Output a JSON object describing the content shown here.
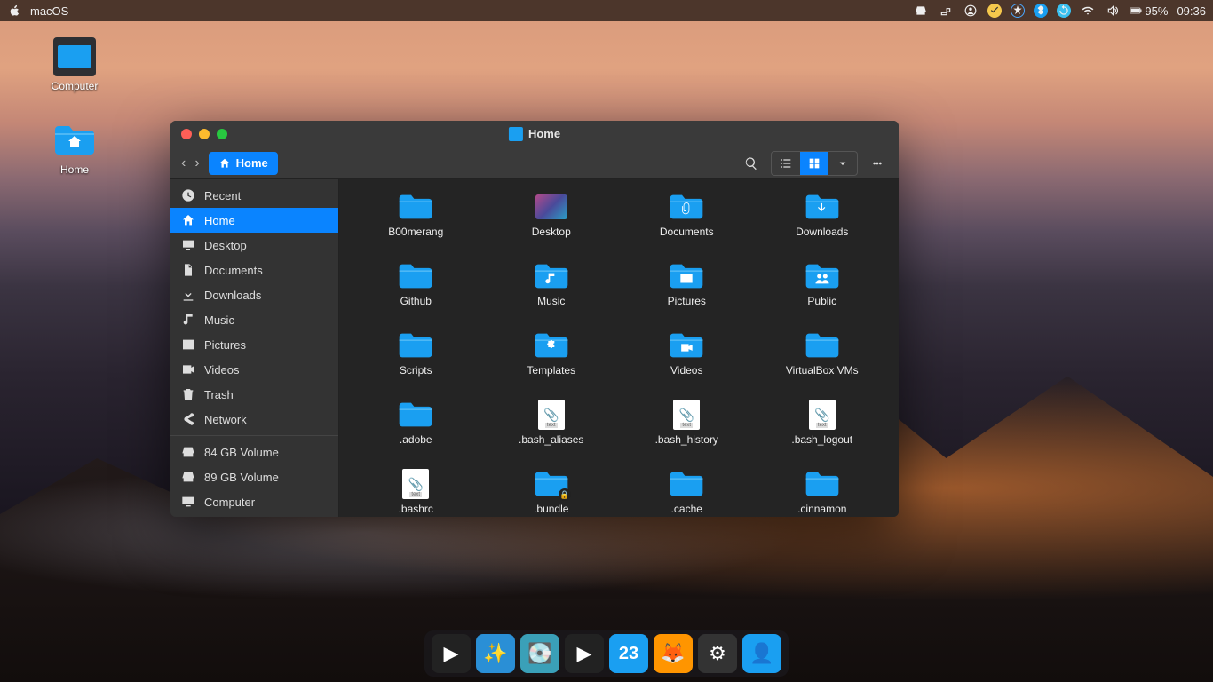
{
  "topbar": {
    "menu_label": "macOS",
    "battery": "95%",
    "clock": "09:36"
  },
  "desktop": {
    "icons": [
      {
        "name": "Computer",
        "kind": "monitor"
      },
      {
        "name": "Home",
        "kind": "home-folder"
      }
    ]
  },
  "file_manager": {
    "title": "Home",
    "location": "Home",
    "sidebar": {
      "places": [
        {
          "label": "Recent",
          "icon": "clock"
        },
        {
          "label": "Home",
          "icon": "home",
          "active": true
        },
        {
          "label": "Desktop",
          "icon": "monitor"
        },
        {
          "label": "Documents",
          "icon": "document"
        },
        {
          "label": "Downloads",
          "icon": "download"
        },
        {
          "label": "Music",
          "icon": "music"
        },
        {
          "label": "Pictures",
          "icon": "picture"
        },
        {
          "label": "Videos",
          "icon": "video"
        },
        {
          "label": "Trash",
          "icon": "trash"
        },
        {
          "label": "Network",
          "icon": "network"
        }
      ],
      "devices": [
        {
          "label": "84 GB Volume",
          "icon": "drive"
        },
        {
          "label": "89 GB Volume",
          "icon": "drive"
        },
        {
          "label": "Computer",
          "icon": "computer"
        }
      ]
    },
    "items": [
      {
        "label": "B00merang",
        "type": "folder"
      },
      {
        "label": "Desktop",
        "type": "desktop"
      },
      {
        "label": "Documents",
        "type": "folder",
        "glyph": "clip"
      },
      {
        "label": "Downloads",
        "type": "folder",
        "glyph": "down"
      },
      {
        "label": "Github",
        "type": "folder"
      },
      {
        "label": "Music",
        "type": "folder",
        "glyph": "music"
      },
      {
        "label": "Pictures",
        "type": "folder",
        "glyph": "pic"
      },
      {
        "label": "Public",
        "type": "folder",
        "glyph": "people"
      },
      {
        "label": "Scripts",
        "type": "folder"
      },
      {
        "label": "Templates",
        "type": "folder",
        "glyph": "puzzle"
      },
      {
        "label": "Videos",
        "type": "folder",
        "glyph": "vid"
      },
      {
        "label": "VirtualBox VMs",
        "type": "folder"
      },
      {
        "label": ".adobe",
        "type": "folder"
      },
      {
        "label": ".bash_aliases",
        "type": "file"
      },
      {
        "label": ".bash_history",
        "type": "file"
      },
      {
        "label": ".bash_logout",
        "type": "file"
      },
      {
        "label": ".bashrc",
        "type": "file"
      },
      {
        "label": ".bundle",
        "type": "folder",
        "locked": true
      },
      {
        "label": ".cache",
        "type": "folder"
      },
      {
        "label": ".cinnamon",
        "type": "folder"
      }
    ]
  },
  "dock": {
    "items": [
      {
        "name": "media-player-1",
        "bg": "#222",
        "emoji": "▶"
      },
      {
        "name": "wizard-app",
        "bg": "#2a8fd6",
        "emoji": "✨"
      },
      {
        "name": "disk-utility",
        "bg": "#3aa0b8",
        "emoji": "💽"
      },
      {
        "name": "media-player-2",
        "bg": "#222",
        "emoji": "▶"
      },
      {
        "name": "calendar",
        "bg": "#1a9ff1",
        "text": "23"
      },
      {
        "name": "firefox",
        "bg": "#ff9500",
        "emoji": "🦊"
      },
      {
        "name": "settings",
        "bg": "#333",
        "emoji": "⚙"
      },
      {
        "name": "people-app",
        "bg": "#1a9ff1",
        "emoji": "👤"
      }
    ]
  }
}
